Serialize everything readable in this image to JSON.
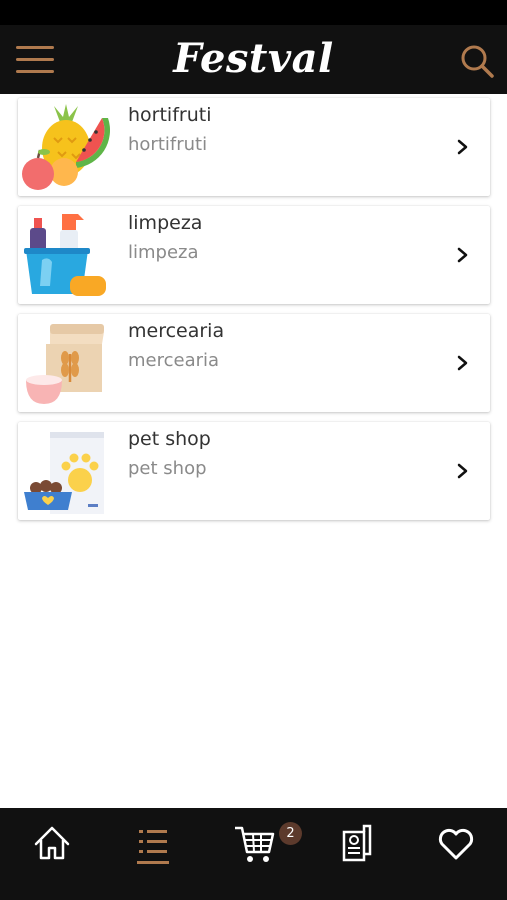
{
  "header": {
    "brand": "Festval",
    "accent_color": "#b07a4e",
    "menu_icon": "hamburger-icon",
    "search_icon": "search-icon"
  },
  "categories": [
    {
      "title": "hortifruti",
      "subtitle": "hortifruti",
      "icon": "fruits-icon"
    },
    {
      "title": "limpeza",
      "subtitle": "limpeza",
      "icon": "cleaning-supplies-icon"
    },
    {
      "title": "mercearia",
      "subtitle": "mercearia",
      "icon": "grocery-bag-icon"
    },
    {
      "title": "pet shop",
      "subtitle": "pet shop",
      "icon": "pet-food-icon"
    }
  ],
  "bottom_nav": {
    "items": [
      {
        "icon": "home-icon",
        "active": false
      },
      {
        "icon": "list-icon",
        "active": true
      },
      {
        "icon": "cart-icon",
        "active": false
      },
      {
        "icon": "receipt-icon",
        "active": false
      },
      {
        "icon": "heart-icon",
        "active": false
      }
    ],
    "cart_count": "2",
    "badge_color": "#5c3a2c"
  }
}
